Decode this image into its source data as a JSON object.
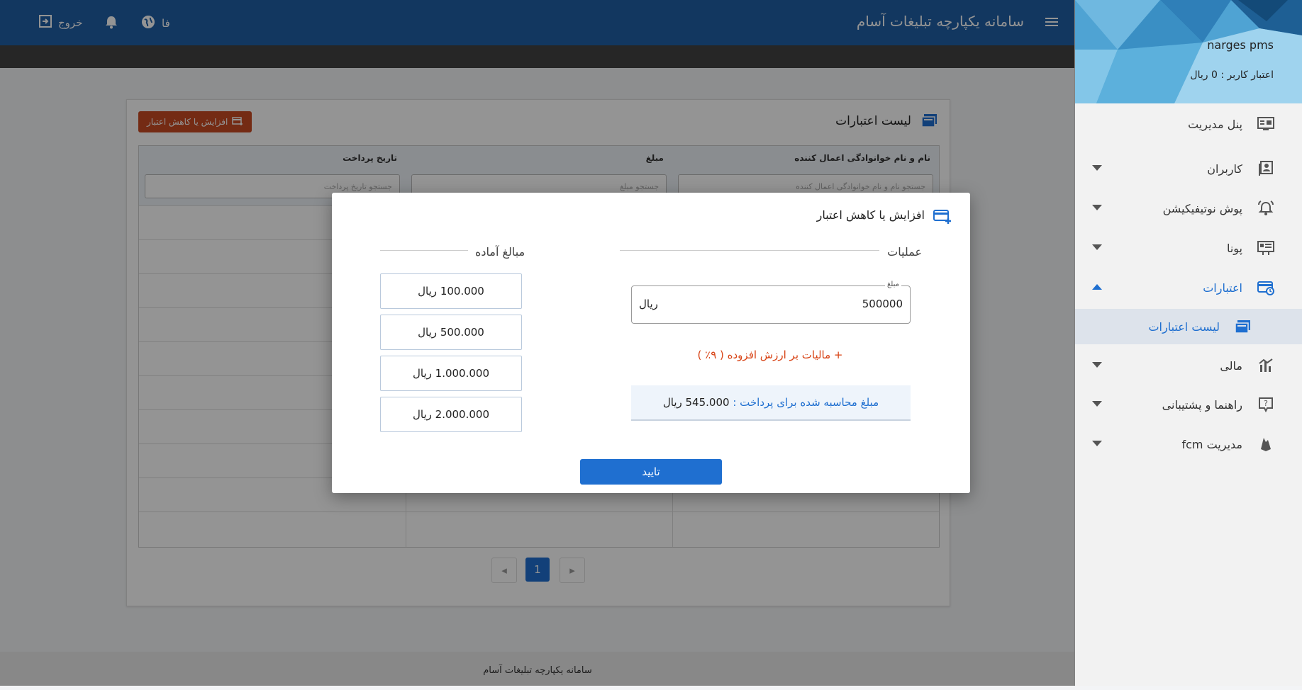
{
  "header": {
    "app_title": "سامانه یکپارچه تبلیغات آسام",
    "language_label": "فا",
    "logout_label": "خروج"
  },
  "sidebar": {
    "username": "narges pms",
    "credit_text": "اعتبار کاربر : 0 ریال",
    "items": [
      {
        "label": "پنل مدیریت",
        "icon": "dashboard-icon"
      },
      {
        "label": "کاربران",
        "icon": "users-icon"
      },
      {
        "label": "پوش نوتیفیکیشن",
        "icon": "bell-ring-icon"
      },
      {
        "label": "پونا",
        "icon": "billboard-icon"
      },
      {
        "label": "اعتبارات",
        "icon": "credit-card-clock-icon"
      },
      {
        "label": "لیست اعتبارات",
        "icon": "list-icon"
      },
      {
        "label": "مالی",
        "icon": "finance-icon"
      },
      {
        "label": "راهنما و پشتیبانی",
        "icon": "help-icon"
      },
      {
        "label": "مدیریت fcm",
        "icon": "firebase-icon"
      }
    ]
  },
  "page": {
    "card_title": "لیست اعتبارات",
    "add_button_label": "افزایش یا کاهش اعتبار",
    "columns": [
      {
        "label": "نام و نام خوانوادگی اعمال کننده",
        "placeholder": "جستجو نام و نام خوانوادگی اعمال کننده"
      },
      {
        "label": "مبلغ",
        "placeholder": "جستجو مبلغ"
      },
      {
        "label": "تاریخ پرداخت",
        "placeholder": "جستجو تاریخ پرداخت"
      }
    ],
    "pagination": {
      "prev": "◂",
      "current": "1",
      "next": "▸"
    },
    "footer": "سامانه یکپارچه تبلیغات آسام"
  },
  "modal": {
    "title": "افزایش یا کاهش اعتبار",
    "operations_heading": "عملیات",
    "presets_heading": "مبالغ آماده",
    "amount_label": "مبلغ",
    "amount_value": "500000",
    "amount_unit": "ریال",
    "vat_text": "+ مالیات بر ارزش افزوده ( ۹٪ )",
    "calc_label": "مبلغ محاسبه شده برای پرداخت :",
    "calc_value": "545.000 ریال",
    "presets": [
      "100.000 ریال",
      "500.000 ریال",
      "1.000.000 ریال",
      "2.000.000 ریال"
    ],
    "confirm_label": "تایید"
  },
  "colors": {
    "primary": "#1f6fd0",
    "header": "#1f5fa6",
    "danger_button": "#c94a24",
    "vat_text": "#d84315"
  }
}
